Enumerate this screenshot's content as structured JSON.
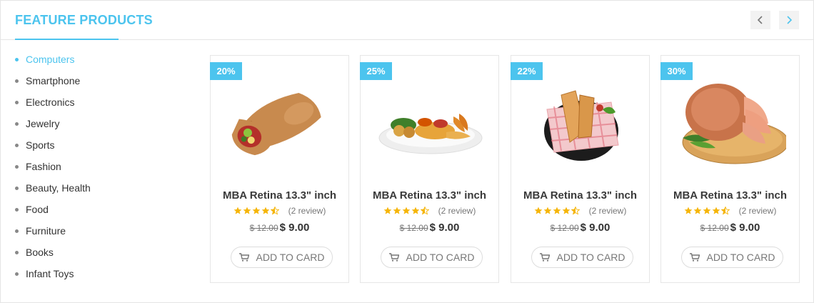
{
  "colors": {
    "accent": "#4cc4ee",
    "star": "#f5b50a"
  },
  "header": {
    "title": "FEATURE PRODUCTS"
  },
  "categories": [
    {
      "label": "Computers",
      "active": true
    },
    {
      "label": "Smartphone"
    },
    {
      "label": "Electronics"
    },
    {
      "label": "Jewelry"
    },
    {
      "label": "Sports"
    },
    {
      "label": "Fashion"
    },
    {
      "label": "Beauty, Health"
    },
    {
      "label": "Food"
    },
    {
      "label": "Furniture"
    },
    {
      "label": "Books"
    },
    {
      "label": "Infant Toys"
    }
  ],
  "products": [
    {
      "badge": "20%",
      "name": "MBA Retina 13.3\" inch",
      "rating": 4.5,
      "review": "(2 review)",
      "old_price": "$ 12.00",
      "new_price": "$ 9.00",
      "cart_label": "ADD TO CARD",
      "image": "wrap-sandwich"
    },
    {
      "badge": "25%",
      "name": "MBA Retina 13.3\" inch",
      "rating": 4.5,
      "review": "(2 review)",
      "old_price": "$ 12.00",
      "new_price": "$ 9.00",
      "cart_label": "ADD TO CARD",
      "image": "fried-shrimp-plate"
    },
    {
      "badge": "22%",
      "name": "MBA Retina 13.3\" inch",
      "rating": 4.5,
      "review": "(2 review)",
      "old_price": "$ 12.00",
      "new_price": "$ 9.00",
      "cart_label": "ADD TO CARD",
      "image": "toast-sandwich-plate"
    },
    {
      "badge": "30%",
      "name": "MBA Retina 13.3\" inch",
      "rating": 4.5,
      "review": "(2 review)",
      "old_price": "$ 12.00",
      "new_price": "$ 9.00",
      "cart_label": "ADD TO CARD",
      "image": "sliced-ham-board"
    }
  ],
  "icons": {
    "prev": "chevron-left-icon",
    "next": "chevron-right-icon",
    "cart": "cart-icon",
    "star": "star-icon"
  }
}
